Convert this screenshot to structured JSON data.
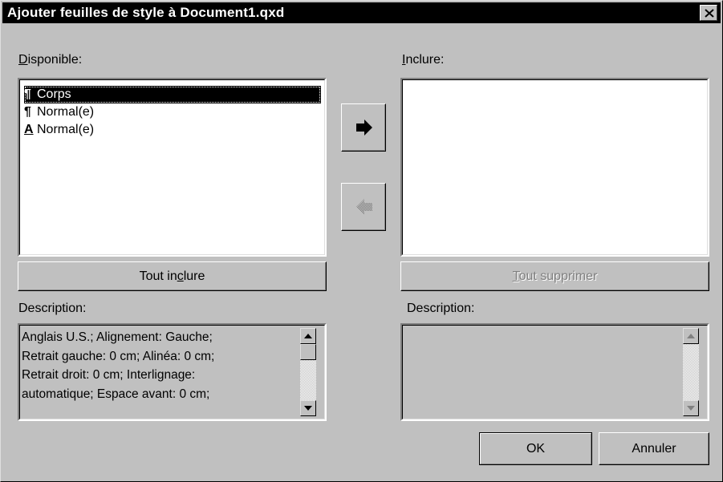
{
  "window": {
    "title": "Ajouter feuilles de style à Document1.qxd",
    "close_icon": "close-icon"
  },
  "available": {
    "label_first": "D",
    "label_rest": "isponible:",
    "items": [
      {
        "glyph": "¶",
        "icon": "paragraph-icon",
        "label": "Corps",
        "selected": true
      },
      {
        "glyph": "¶",
        "icon": "paragraph-icon",
        "label": "Normal(e)",
        "selected": false
      },
      {
        "glyph": "A",
        "icon": "character-style-icon",
        "label": "Normal(e)",
        "selected": false
      }
    ],
    "include_all_pre": "Tout in",
    "include_all_accel": "c",
    "include_all_post": "lure"
  },
  "include": {
    "label_first": "I",
    "label_rest": "nclure:",
    "remove_all_accel": "T",
    "remove_all_rest": "out supprimer",
    "remove_all_enabled": false
  },
  "arrows": {
    "add_icon": "arrow-right-icon",
    "remove_icon": "arrow-left-icon",
    "remove_enabled": false
  },
  "description_left": {
    "label": "Description:",
    "lines": [
      "Anglais U.S.;  Alignement: Gauche;",
      "Retrait gauche: 0 cm;  Alinéa: 0 cm;",
      "Retrait droit: 0 cm;  Interlignage:",
      "automatique;  Espace avant: 0 cm;"
    ]
  },
  "description_right": {
    "label": "Description:"
  },
  "buttons": {
    "ok": "OK",
    "cancel": "Annuler"
  },
  "colors": {
    "face": "#c0c0c0",
    "title_bg": "#000000",
    "selection": "#000000",
    "disabled_text": "#808080"
  }
}
